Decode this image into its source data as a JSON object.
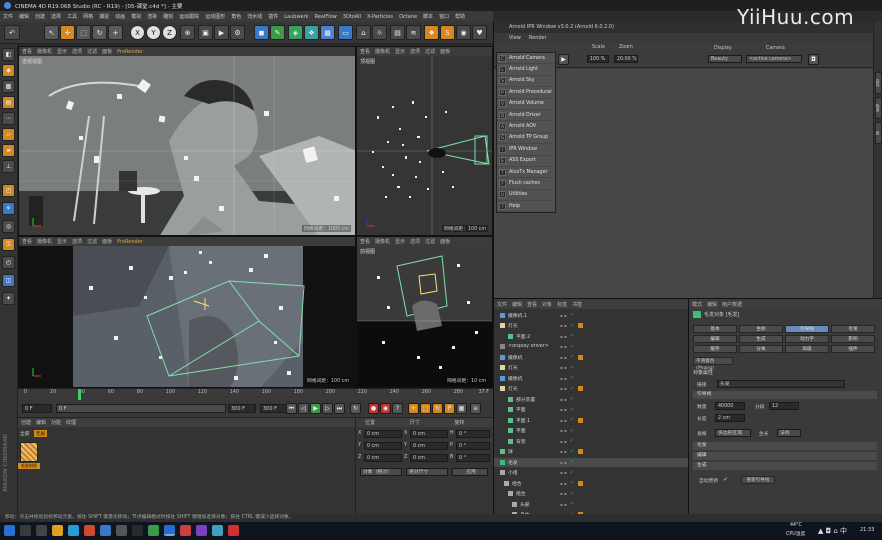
{
  "window": {
    "title": "CINEMA 4D R19.068 Studio (RC - R19) - [05-课堂.c4d *] - 主要",
    "watermark": "YiiHuu.com"
  },
  "menubar": [
    "文件",
    "编辑",
    "创建",
    "选择",
    "工具",
    "网格",
    "捕捉",
    "动画",
    "模拟",
    "渲染",
    "雕刻",
    "运动跟踪",
    "运动图形",
    "角色",
    "流水线",
    "插件",
    "Laubwerk",
    "RealFlow",
    "3DtoAll",
    "X-Particles",
    "Octane",
    "脚本",
    "窗口",
    "帮助"
  ],
  "toolbar": {
    "x": "X",
    "y": "Y",
    "z": "Z"
  },
  "viewports": {
    "tabs": [
      "查看",
      "摄像机",
      "显示",
      "选项",
      "过滤",
      "面板"
    ],
    "prorender": "ProRender",
    "top_left": {
      "label": "透视视图",
      "grid": "网格间距：1000 cm"
    },
    "top_right": {
      "label": "顶视图",
      "grid": "网格间距：100 cm"
    },
    "bottom_left": {
      "label": "",
      "grid": "网格间距：100 cm"
    },
    "bottom_right": {
      "label": "前视图",
      "grid": "网格间距：10 cm"
    }
  },
  "timeline": {
    "ticks": [
      "0",
      "20",
      "40",
      "60",
      "80",
      "100",
      "120",
      "140",
      "160",
      "180",
      "200",
      "220",
      "240",
      "260",
      "280"
    ],
    "current_frame": "37 F",
    "start": "0 F",
    "start2": "0 F",
    "end": "300 F",
    "end2": "300 F"
  },
  "material": {
    "tabs": [
      "创建",
      "编辑",
      "功能",
      "纹理"
    ],
    "filters": [
      "全部",
      "无层"
    ],
    "item_label": "毛发材质"
  },
  "coords": {
    "headers": [
      "位置",
      "尺寸",
      "旋转"
    ],
    "rows": [
      {
        "axis": "X",
        "pos": "0 cm",
        "size": "0 cm",
        "rot_label": "H",
        "rot": "0 °"
      },
      {
        "axis": "Y",
        "pos": "0 cm",
        "size": "0 cm",
        "rot_label": "P",
        "rot": "0 °"
      },
      {
        "axis": "Z",
        "pos": "0 cm",
        "size": "0 cm",
        "rot_label": "B",
        "rot": "0 °"
      }
    ],
    "mode": "对象（相对）",
    "size_mode": "绝对尺寸",
    "apply": "应用"
  },
  "status": "移动：点击并拖动鼠标移动元素。按住 SHIFT 键量化移动；节点编辑模式时按住 SHIFT 键增加选择对象；按住 CTRL 键减少选择对象。",
  "arnold": {
    "title": "Arnold IPR Window v3.0.2 (Arnold 6.0.2.0)",
    "menu": [
      "View",
      "Render"
    ],
    "scale_label": "Scale",
    "zoom_label": "Zoom",
    "scale": "100 %",
    "zoom": "20.00 %",
    "display_label": "Display",
    "display": "Beauty",
    "camera_label": "Camera",
    "camera": "<active camera>",
    "dropdown": [
      {
        "icon": "C",
        "label": "Arnold Camera"
      },
      {
        "icon": "L",
        "label": "Arnold Light"
      },
      {
        "icon": "S",
        "label": "Arnold Sky"
      },
      {
        "icon": "P",
        "label": "Arnold Procedural"
      },
      {
        "icon": "V",
        "label": "Arnold Volume"
      },
      {
        "icon": "D",
        "label": "Arnold Driver"
      },
      {
        "icon": "A",
        "label": "Arnold AOV"
      },
      {
        "icon": "G",
        "label": "Arnold TP Group"
      },
      {
        "icon": "I",
        "label": "IPR Window"
      },
      {
        "icon": "E",
        "label": "ASS Export"
      },
      {
        "icon": "T",
        "label": "AiceTx Manager"
      },
      {
        "icon": "F",
        "label": "Flush caches"
      },
      {
        "icon": "U",
        "label": "Utilities"
      },
      {
        "icon": "?",
        "label": "Help"
      }
    ]
  },
  "objects": {
    "menu": [
      "文件",
      "编辑",
      "查看",
      "对象",
      "标签",
      "书签"
    ],
    "rows": [
      "摄像机.1",
      "灯光",
      "平面.2",
      "<display driver>",
      "摄像机",
      "灯光",
      "摄像机",
      "灯光",
      "部分装置",
      "平面",
      "平面.1",
      "平面",
      "背景",
      "球",
      "毛发",
      "小组",
      "组合",
      "组合",
      "头部",
      "身体"
    ]
  },
  "attributes": {
    "menu": [
      "模式",
      "编辑",
      "用户数据"
    ],
    "title": "毛发对象 [毛发]",
    "buttons": [
      "基本",
      "坐标",
      "引导线",
      "毛发",
      "编辑",
      "生成",
      "动力学",
      "影响",
      "缓存",
      "分离",
      "高级",
      "插件"
    ],
    "plugin": "平滑着色(Phong)",
    "section_object": "对象属性",
    "link_label": "链接",
    "link_value": "头发",
    "section_guides": "引导线",
    "count_label": "数量",
    "count": "40000",
    "segments_label": "分段",
    "segments": "12",
    "length_label": "长度",
    "length": "2 cm",
    "root_label": "发根",
    "root": "多边形区域",
    "grow_label": "生长",
    "grow": "法线",
    "sections": [
      "毛发",
      "编辑",
      "生成"
    ],
    "auto_update": "自动更新",
    "regen": "重新引导线"
  },
  "taskbar": {
    "temp": "44°C",
    "cpu": "CPU温度",
    "time": "21:33"
  }
}
